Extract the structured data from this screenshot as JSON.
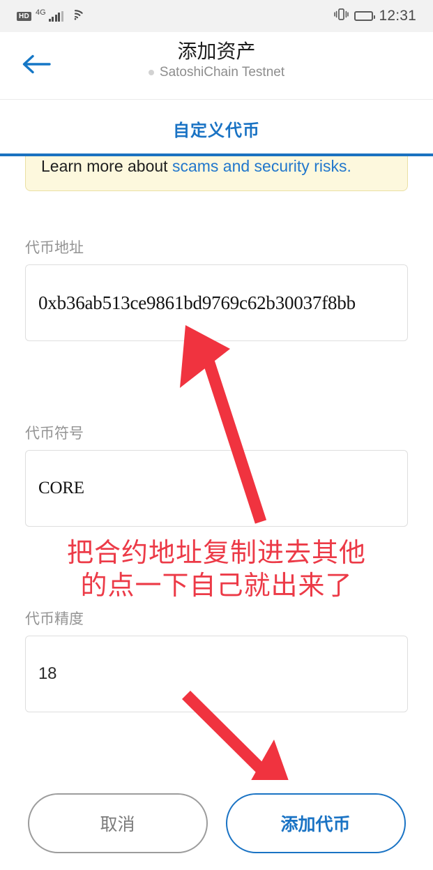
{
  "statusbar": {
    "hd_label": "HD",
    "network_label": "4G",
    "time": "12:31",
    "icons": [
      "hd-icon",
      "signal-bars-icon",
      "wifi-icon",
      "vibrate-icon",
      "battery-icon"
    ]
  },
  "header": {
    "back_icon": "back-arrow-icon",
    "title": "添加资产",
    "subtitle": "SatoshiChain Testnet"
  },
  "tabs": [
    {
      "label": "自定义代币",
      "active": true
    }
  ],
  "warning": {
    "text_before": "Learn more about ",
    "link_text": "scams and security risks.",
    "text_after": ""
  },
  "form": {
    "fields": [
      {
        "label": "代币地址",
        "value": "0xb36ab513ce9861bd9769c62b30037f8bb",
        "placeholder": "",
        "name": "token-address"
      },
      {
        "label": "代币符号",
        "value": "CORE",
        "placeholder": "",
        "name": "token-symbol"
      },
      {
        "label": "代币精度",
        "value": "18",
        "placeholder": "",
        "name": "token-decimals"
      }
    ]
  },
  "annotation": {
    "text": "把合约地址复制进去其他\n的点一下自己就出来了",
    "color": "#ec3a47"
  },
  "footer": {
    "cancel_label": "取消",
    "add_label": "添加代币"
  },
  "colors": {
    "accent": "#1a73c4",
    "warning_bg": "#fdf8dd",
    "warning_border": "#eadfa4",
    "annotation_red": "#ec3a47",
    "arrow_red": "#f0333f"
  }
}
